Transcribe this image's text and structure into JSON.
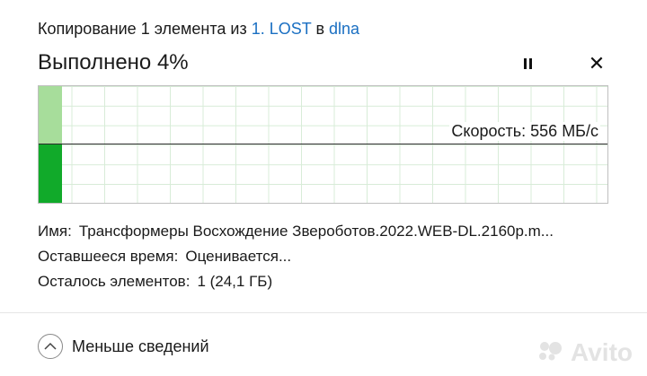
{
  "dialog": {
    "title_prefix": "Копирование 1 элемента из",
    "source": "1. LOST",
    "title_in": "в",
    "destination": "dlna",
    "status_title": "Выполнено 4%",
    "progress_fraction": 0.04,
    "close_glyph": "✕",
    "pause_icon": "pause-icon"
  },
  "graph": {
    "speed_label": "Скорость:",
    "speed_value": "556 МБ/с",
    "colors": {
      "done_light": "#a7dd9b",
      "done_dark": "#11aa2a",
      "grid": "#d8ecd8"
    }
  },
  "details": {
    "name_label": "Имя:",
    "name_value": "Трансформеры Восхождение Звероботов.2022.WEB-DL.2160p.m...",
    "time_label": "Оставшееся время:",
    "time_value": "Оценивается...",
    "items_label": "Осталось элементов:",
    "items_value": "1 (24,1 ГБ)"
  },
  "footer": {
    "less_details": "Меньше сведений",
    "chevron_icon": "chevron-up-icon"
  },
  "watermark": {
    "text": "Avito"
  }
}
